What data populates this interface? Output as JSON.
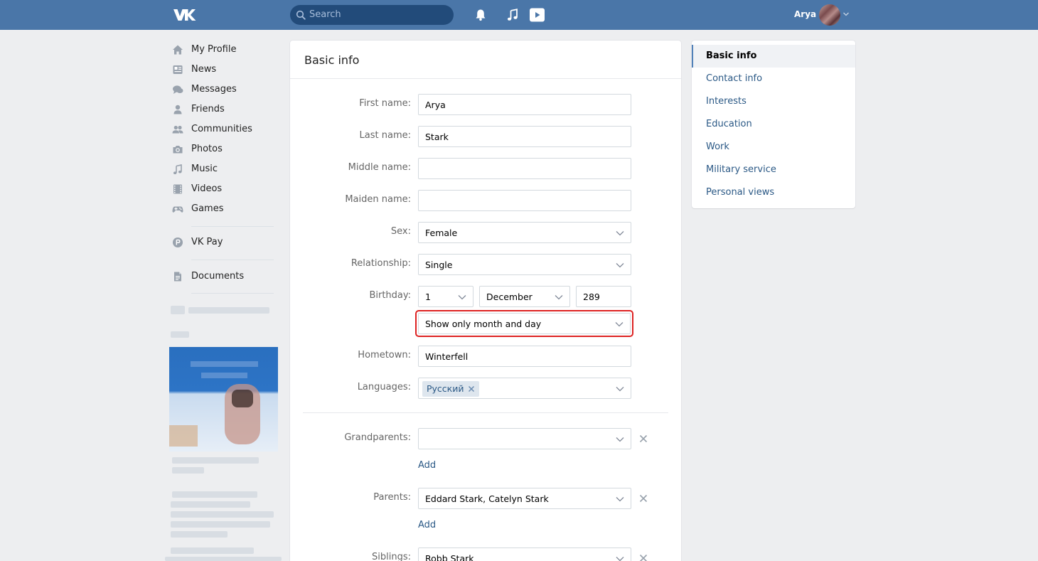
{
  "header": {
    "search_placeholder": "Search",
    "user_name": "Arya",
    "icons": [
      "vk-logo-icon",
      "search-icon",
      "bell-icon",
      "music-note-icon",
      "video-play-icon",
      "chevron-down-icon"
    ]
  },
  "left_nav": {
    "items": [
      {
        "label": "My Profile",
        "icon": "home-icon"
      },
      {
        "label": "News",
        "icon": "news-icon"
      },
      {
        "label": "Messages",
        "icon": "messages-icon"
      },
      {
        "label": "Friends",
        "icon": "friend-icon"
      },
      {
        "label": "Communities",
        "icon": "communities-icon"
      },
      {
        "label": "Photos",
        "icon": "camera-icon"
      },
      {
        "label": "Music",
        "icon": "music-icon"
      },
      {
        "label": "Videos",
        "icon": "film-icon"
      },
      {
        "label": "Games",
        "icon": "gamepad-icon"
      }
    ],
    "pay": {
      "label": "VK Pay",
      "icon": "vk-pay-icon"
    },
    "documents": {
      "label": "Documents",
      "icon": "document-icon"
    }
  },
  "main": {
    "title": "Basic info",
    "labels": {
      "first_name": "First name:",
      "last_name": "Last name:",
      "middle_name": "Middle name:",
      "maiden_name": "Maiden name:",
      "sex": "Sex:",
      "relationship": "Relationship:",
      "birthday": "Birthday:",
      "hometown": "Hometown:",
      "languages": "Languages:",
      "grandparents": "Grandparents:",
      "parents": "Parents:",
      "siblings": "Siblings:"
    },
    "values": {
      "first_name": "Arya",
      "last_name": "Stark",
      "middle_name": "",
      "maiden_name": "",
      "sex": "Female",
      "relationship": "Single",
      "birthday_day": "1",
      "birthday_month": "December",
      "birthday_year": "289",
      "birthday_visibility": "Show only month and day",
      "hometown": "Winterfell",
      "language_tag": "Русский",
      "grandparents": "",
      "parents": "Eddard Stark, Catelyn Stark",
      "siblings": "Robb Stark"
    },
    "add_label": "Add",
    "highlight_color": "#dd2222"
  },
  "right_menu": {
    "items": [
      {
        "label": "Basic info",
        "active": true
      },
      {
        "label": "Contact info",
        "active": false
      },
      {
        "label": "Interests",
        "active": false
      },
      {
        "label": "Education",
        "active": false
      },
      {
        "label": "Work",
        "active": false
      },
      {
        "label": "Military service",
        "active": false
      },
      {
        "label": "Personal views",
        "active": false
      }
    ]
  },
  "colors": {
    "header_bg": "#4a76a8",
    "link": "#2a5885",
    "page_bg": "#edeef0"
  }
}
